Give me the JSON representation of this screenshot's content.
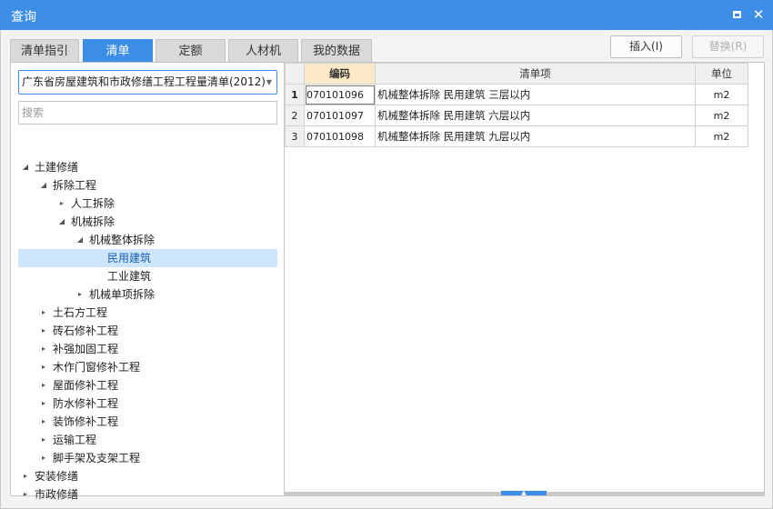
{
  "window": {
    "title": "查询",
    "maximize_icon": "maximize-icon",
    "close_icon": "close-icon",
    "close_glyph": "✕"
  },
  "tabs": [
    {
      "label": "清单指引",
      "active": false
    },
    {
      "label": "清单",
      "active": true
    },
    {
      "label": "定额",
      "active": false
    },
    {
      "label": "人材机",
      "active": false
    },
    {
      "label": "我的数据",
      "active": false
    }
  ],
  "actions": {
    "insert_label": "插入(I)",
    "replace_label": "替换(R)",
    "replace_enabled": false
  },
  "left": {
    "library_select": "广东省房屋建筑和市政修缮工程工程量清单(2012)",
    "search_placeholder": "搜索",
    "tree": [
      {
        "label": "土建修缮",
        "state": "expanded",
        "level": 0
      },
      {
        "label": "拆除工程",
        "state": "expanded",
        "level": 1
      },
      {
        "label": "人工拆除",
        "state": "collapsed",
        "level": 2
      },
      {
        "label": "机械拆除",
        "state": "expanded",
        "level": 2
      },
      {
        "label": "机械整体拆除",
        "state": "expanded",
        "level": 3
      },
      {
        "label": "民用建筑",
        "state": "leaf",
        "level": 4,
        "selected": true
      },
      {
        "label": "工业建筑",
        "state": "leaf",
        "level": 4
      },
      {
        "label": "机械单项拆除",
        "state": "collapsed",
        "level": 3
      },
      {
        "label": "土石方工程",
        "state": "collapsed",
        "level": 1
      },
      {
        "label": "砖石修补工程",
        "state": "collapsed",
        "level": 1
      },
      {
        "label": "补强加固工程",
        "state": "collapsed",
        "level": 1
      },
      {
        "label": "木作门窗修补工程",
        "state": "collapsed",
        "level": 1
      },
      {
        "label": "屋面修补工程",
        "state": "collapsed",
        "level": 1
      },
      {
        "label": "防水修补工程",
        "state": "collapsed",
        "level": 1
      },
      {
        "label": "装饰修补工程",
        "state": "collapsed",
        "level": 1
      },
      {
        "label": "运输工程",
        "state": "collapsed",
        "level": 1
      },
      {
        "label": "脚手架及支架工程",
        "state": "collapsed",
        "level": 1
      },
      {
        "label": "安装修缮",
        "state": "collapsed",
        "level": 0
      },
      {
        "label": "市政修缮",
        "state": "collapsed",
        "level": 0
      }
    ]
  },
  "grid": {
    "columns": [
      "编码",
      "清单项",
      "单位"
    ],
    "rows": [
      {
        "no": "1",
        "code": "070101096",
        "item": "机械整体拆除 民用建筑 三层以内",
        "unit": "m2"
      },
      {
        "no": "2",
        "code": "070101097",
        "item": "机械整体拆除 民用建筑 六层以内",
        "unit": "m2"
      },
      {
        "no": "3",
        "code": "070101098",
        "item": "机械整体拆除 民用建筑 九层以内",
        "unit": "m2"
      }
    ]
  },
  "colors": {
    "accent": "#3d8ee6",
    "selected_row": "#cde6fb",
    "sorted_header": "#fbe8c7"
  }
}
